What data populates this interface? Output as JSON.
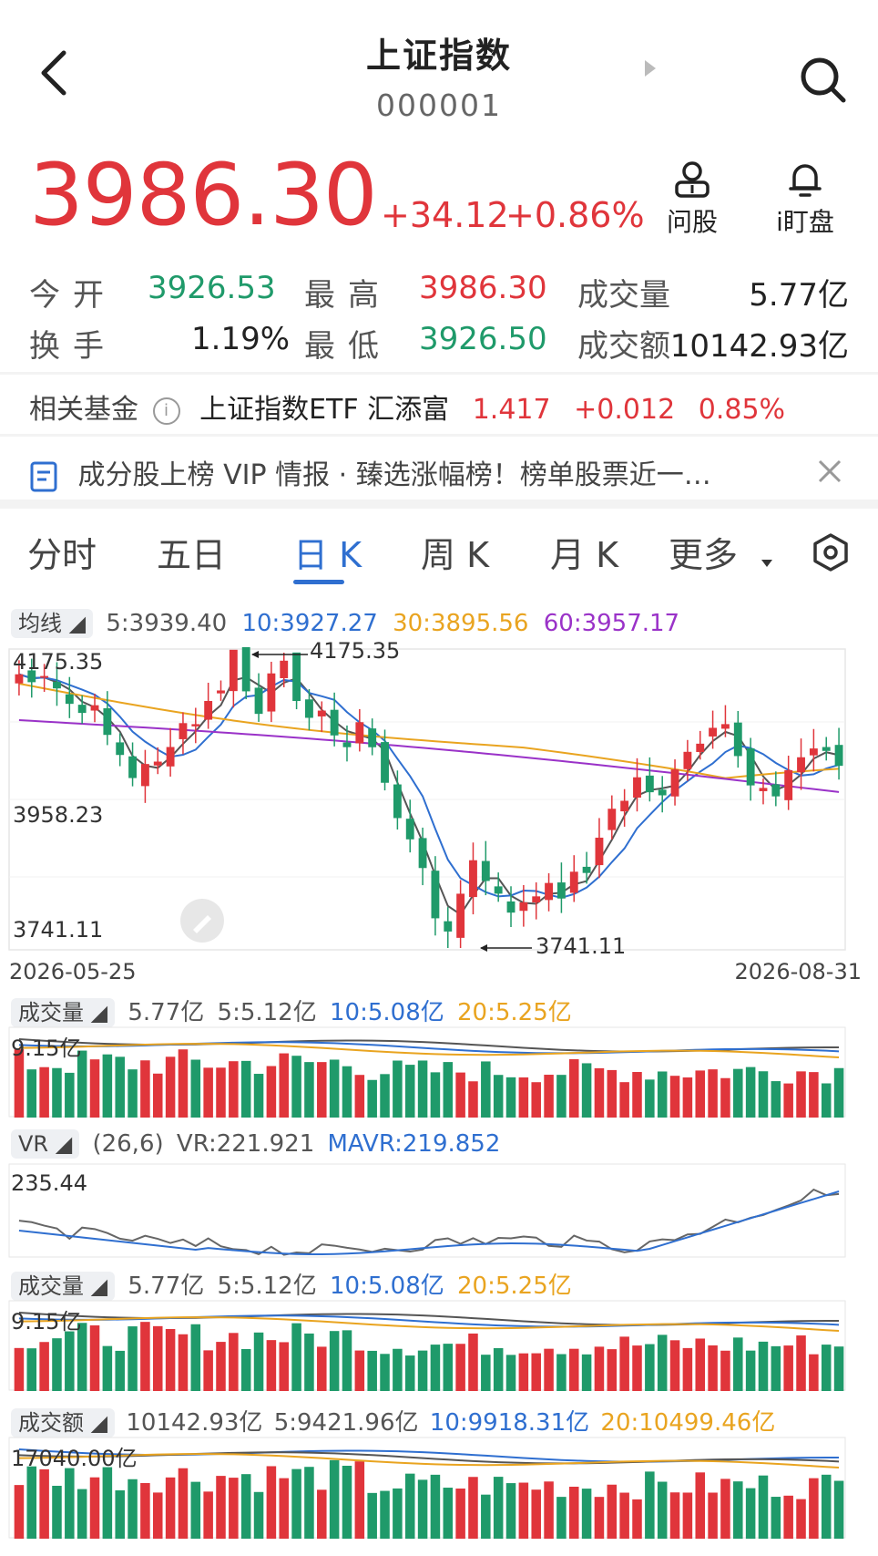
{
  "header": {
    "title": "上证指数",
    "code": "000001"
  },
  "quote": {
    "price": "3986.30",
    "change": "+34.12",
    "change_pct": "+0.86%"
  },
  "actions": {
    "ask": "问股",
    "watch": "i盯盘"
  },
  "stats": {
    "open_label": "今开",
    "open": "3926.53",
    "high_label": "最高",
    "high": "3986.30",
    "volume_label": "成交量",
    "volume": "5.77亿",
    "turnover_label": "换手",
    "turnover": "1.19%",
    "low_label": "最低",
    "low": "3926.50",
    "amount_label": "成交额",
    "amount": "10142.93亿"
  },
  "fund": {
    "label": "相关基金",
    "name": "上证指数ETF 汇添富",
    "price": "1.417",
    "change": "+0.012",
    "pct": "0.85%"
  },
  "notice": {
    "text": "成分股上榜 VIP 情报 · 臻选涨幅榜！榜单股票近一…"
  },
  "tabs": [
    "分时",
    "五日",
    "日 K",
    "周 K",
    "月 K",
    "更多"
  ],
  "active_tab": 2,
  "ma_legend": {
    "chip": "均线",
    "ma5": "5:3939.40",
    "ma10": "10:3927.27",
    "ma30": "30:3895.56",
    "ma60": "60:3957.17"
  },
  "kline": {
    "y_top": "4175.35",
    "y_mid": "3958.23",
    "y_bot": "3741.11",
    "max_label": "4175.35",
    "min_label": "3741.11",
    "date_start": "2026-05-25",
    "date_end": "2026-08-31"
  },
  "vol1": {
    "chip": "成交量",
    "v": "5.77亿",
    "m5": "5:5.12亿",
    "m10": "10:5.08亿",
    "m20": "20:5.25亿",
    "axis": "9.15亿"
  },
  "vr": {
    "chip": "VR",
    "params": "(26,6)",
    "vr": "VR:221.921",
    "mavr": "MAVR:219.852",
    "axis": "235.44"
  },
  "vol2": {
    "chip": "成交量",
    "v": "5.77亿",
    "m5": "5:5.12亿",
    "m10": "10:5.08亿",
    "m20": "20:5.25亿",
    "axis": "9.15亿"
  },
  "amt": {
    "chip": "成交额",
    "v": "10142.93亿",
    "m5": "5:9421.96亿",
    "m10": "10:9918.31亿",
    "m20": "20:10499.46亿",
    "axis": "17040.00亿"
  },
  "colors": {
    "up": "#e0353b",
    "down": "#1f9a6a",
    "ma5": "#555555",
    "ma10": "#2f6fd0",
    "ma30": "#e9a420",
    "ma60": "#9a32c8"
  }
}
